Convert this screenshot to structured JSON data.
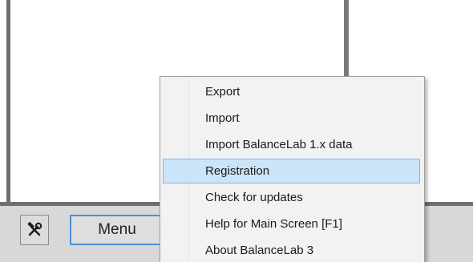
{
  "toolbar": {
    "tools_icon": "tools-icon",
    "menu_label": "Menu"
  },
  "context_menu": {
    "items": [
      {
        "label": "Export",
        "selected": false
      },
      {
        "label": "Import",
        "selected": false
      },
      {
        "label": "Import BalanceLab 1.x data",
        "selected": false
      },
      {
        "label": "Registration",
        "selected": true
      },
      {
        "label": "Check for updates",
        "selected": false
      },
      {
        "label": "Help for Main Screen [F1]",
        "selected": false
      },
      {
        "label": "About BalanceLab 3",
        "selected": false
      }
    ]
  },
  "colors": {
    "highlight_fill": "#cce4f7",
    "highlight_border": "#7eb4ea",
    "menu_button_border": "#4a8fd6"
  }
}
